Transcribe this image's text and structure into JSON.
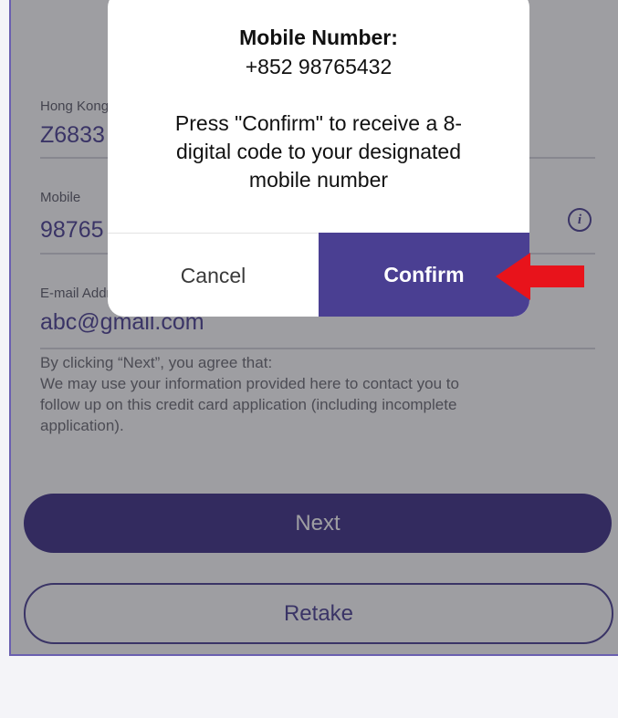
{
  "form": {
    "hkid": {
      "label": "Hong Kong",
      "value": "Z6833"
    },
    "mobile": {
      "label": "Mobile",
      "value": "98765"
    },
    "email": {
      "label": "E-mail Address",
      "value": "abc@gmail.com"
    }
  },
  "consent": {
    "lines": [
      "By clicking “Next”, you agree that:",
      "We may use your information provided here to contact you to",
      "follow up on this credit card application (including incomplete",
      "application)."
    ]
  },
  "buttons": {
    "next": "Next",
    "retake": "Retake"
  },
  "dialog": {
    "title": "Mobile Number:",
    "number": "+852 98765432",
    "message_lines": [
      "Press \"Confirm\" to receive a 8-",
      "digital code to your designated",
      "mobile number"
    ],
    "cancel": "Cancel",
    "confirm": "Confirm"
  },
  "colors": {
    "accent": "#4a3f92",
    "next_button": "#3d2f86",
    "arrow": "#e8131b"
  },
  "icons": {
    "info": "info-icon",
    "annotation_arrow": "left-arrow-icon"
  }
}
